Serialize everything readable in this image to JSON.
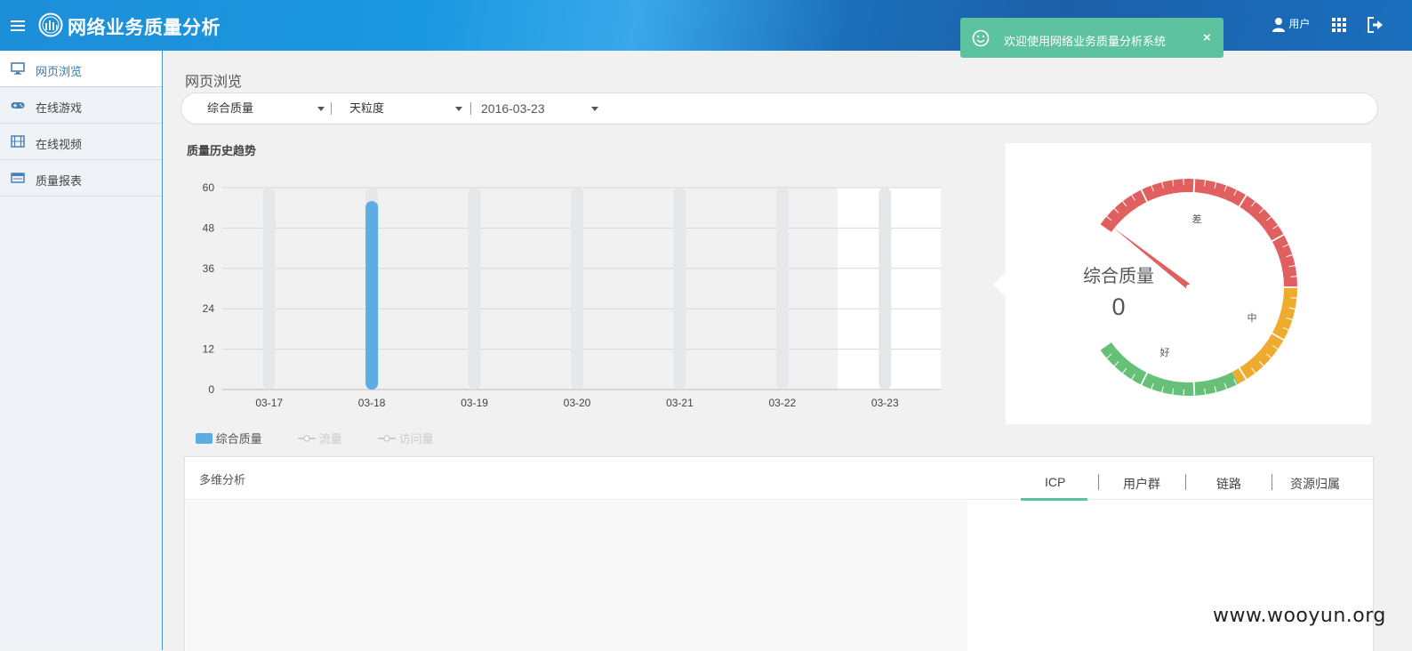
{
  "header": {
    "app_title": "网络业务质量分析",
    "user_label": "用户",
    "icons": [
      "menu-icon",
      "logo-icon",
      "user-icon",
      "apps-grid-icon",
      "logout-icon"
    ]
  },
  "toast": {
    "message": "欢迎使用网络业务质量分析系统",
    "close": "×",
    "color": "#5cc2a0"
  },
  "sidebar": {
    "items": [
      {
        "label": "网页浏览",
        "icon": "monitor-icon",
        "active": true
      },
      {
        "label": "在线游戏",
        "icon": "gamepad-icon",
        "active": false
      },
      {
        "label": "在线视频",
        "icon": "film-icon",
        "active": false
      },
      {
        "label": "质量报表",
        "icon": "report-icon",
        "active": false
      }
    ]
  },
  "page": {
    "title": "网页浏览"
  },
  "filters": {
    "metric": "综合质量",
    "granularity": "天粒度",
    "date": "2016-03-23"
  },
  "trend": {
    "title": "质量历史趋势",
    "legend": [
      {
        "label": "综合质量",
        "active": true,
        "color": "#5dade2"
      },
      {
        "label": "流量",
        "active": false,
        "color": "#cccccc"
      },
      {
        "label": "访问量",
        "active": false,
        "color": "#cccccc"
      }
    ]
  },
  "chart_data": {
    "type": "bar",
    "title": "质量历史趋势",
    "categories": [
      "03-17",
      "03-18",
      "03-19",
      "03-20",
      "03-21",
      "03-22",
      "03-23"
    ],
    "series": [
      {
        "name": "综合质量",
        "values": [
          0,
          56,
          0,
          0,
          0,
          0,
          0
        ]
      }
    ],
    "y_ticks": [
      "0",
      "12",
      "24",
      "36",
      "48",
      "60"
    ],
    "ylim": [
      0,
      60
    ],
    "grid": true,
    "legend_position": "bottom-left"
  },
  "gauge": {
    "label": "综合质量",
    "value": "0",
    "zone_labels": {
      "bad": "差",
      "medium": "中",
      "good": "好"
    },
    "colors": {
      "bad": "#e0605f",
      "medium": "#efab2e",
      "good": "#67c077"
    }
  },
  "multi": {
    "title": "多维分析",
    "tabs": [
      "ICP",
      "用户群",
      "链路",
      "资源归属"
    ],
    "active_tab": "ICP",
    "accent": "#5cc2a0"
  },
  "watermark": "www.wooyun.org"
}
